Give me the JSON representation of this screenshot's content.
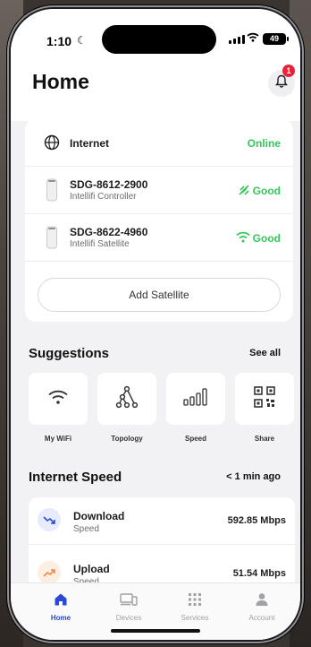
{
  "status_bar": {
    "time": "1:10",
    "battery": "49"
  },
  "header": {
    "title": "Home",
    "notification_count": "1"
  },
  "network": {
    "internet": {
      "label": "Internet",
      "status": "Online"
    },
    "devices": [
      {
        "name": "SDG-8612-2900",
        "type": "Intellifi Controller",
        "status": "Good",
        "icon": "signal-strong-icon"
      },
      {
        "name": "SDG-8622-4960",
        "type": "Intellifi Satellite",
        "status": "Good",
        "icon": "wifi-icon"
      }
    ],
    "add_button": "Add Satellite"
  },
  "suggestions": {
    "title": "Suggestions",
    "see_all": "See all",
    "items": [
      {
        "label": "My WiFi",
        "icon": "wifi-icon"
      },
      {
        "label": "Topology",
        "icon": "topology-icon"
      },
      {
        "label": "Speed",
        "icon": "bars-icon"
      },
      {
        "label": "Share",
        "icon": "qr-icon"
      }
    ]
  },
  "internet_speed": {
    "title": "Internet Speed",
    "updated": "< 1 min ago",
    "rows": [
      {
        "label": "Download",
        "sub": "Speed",
        "value": "592.85 Mbps"
      },
      {
        "label": "Upload",
        "sub": "Speed",
        "value": "51.54 Mbps"
      }
    ]
  },
  "tabs": [
    {
      "label": "Home",
      "active": true
    },
    {
      "label": "Devices",
      "active": false
    },
    {
      "label": "Services",
      "active": false
    },
    {
      "label": "Account",
      "active": false
    }
  ],
  "colors": {
    "accent": "#2a49d8",
    "online": "#34c759",
    "badge": "#e5243b"
  }
}
